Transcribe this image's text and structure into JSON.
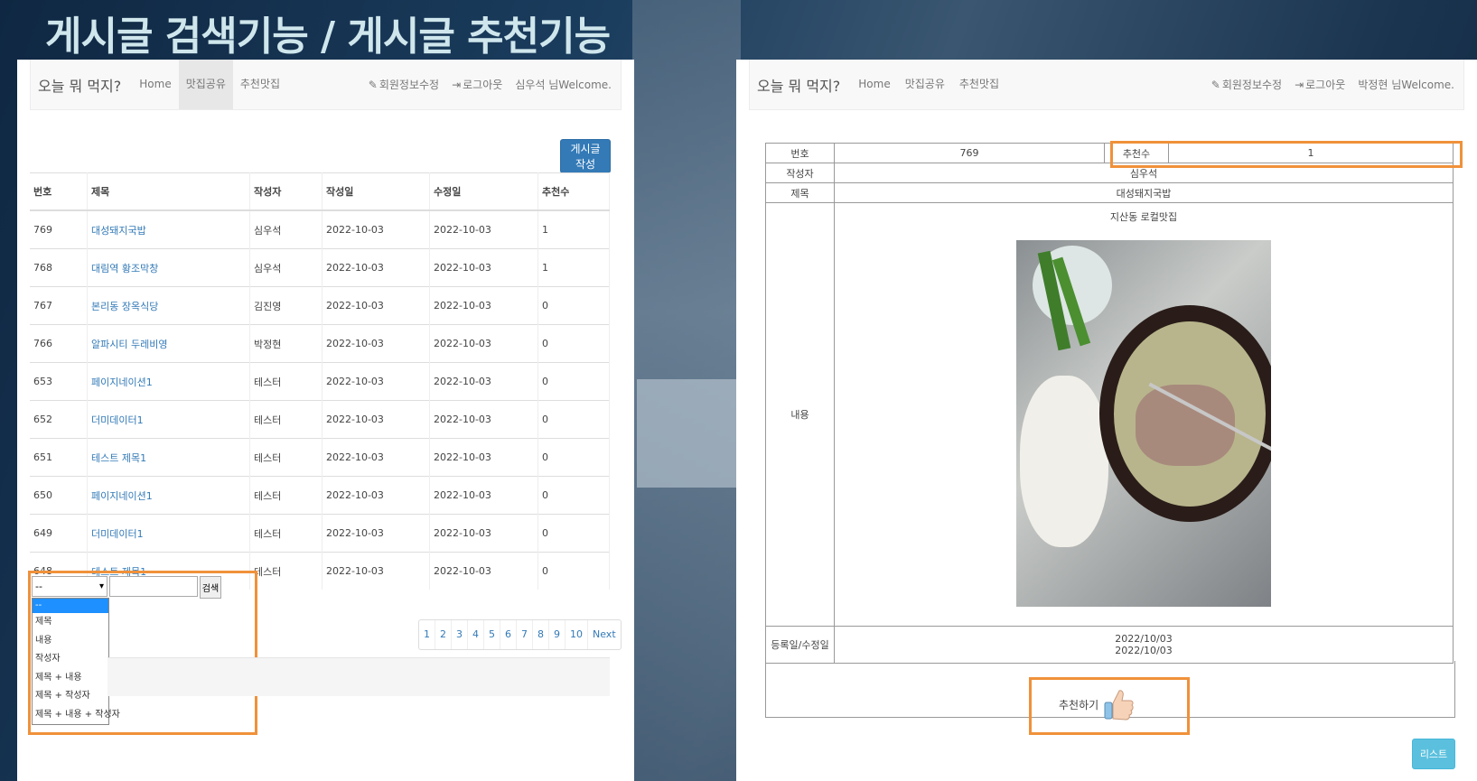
{
  "slide_title": "게시글 검색기능 / 게시글 추천기능",
  "left": {
    "nav": {
      "brand": "오늘 뭐 먹지?",
      "links": [
        "Home",
        "맛집공유",
        "추천맛집"
      ],
      "edit_profile": "회원정보수정",
      "logout": "로그아웃",
      "welcome": "심우석 님Welcome."
    },
    "write_button": "게시글 작성",
    "table": {
      "headers": [
        "번호",
        "제목",
        "작성자",
        "작성일",
        "수정일",
        "추천수"
      ],
      "rows": [
        [
          "769",
          "대성돼지국밥",
          "심우석",
          "2022-10-03",
          "2022-10-03",
          "1"
        ],
        [
          "768",
          "대림역 황조막창",
          "심우석",
          "2022-10-03",
          "2022-10-03",
          "1"
        ],
        [
          "767",
          "본리동 장옥식당",
          "김진영",
          "2022-10-03",
          "2022-10-03",
          "0"
        ],
        [
          "766",
          "알파시티 두레비영",
          "박정현",
          "2022-10-03",
          "2022-10-03",
          "0"
        ],
        [
          "653",
          "페이지네이션1",
          "테스터",
          "2022-10-03",
          "2022-10-03",
          "0"
        ],
        [
          "652",
          "더미데이터1",
          "테스터",
          "2022-10-03",
          "2022-10-03",
          "0"
        ],
        [
          "651",
          "테스트 제목1",
          "테스터",
          "2022-10-03",
          "2022-10-03",
          "0"
        ],
        [
          "650",
          "페이지네이션1",
          "테스터",
          "2022-10-03",
          "2022-10-03",
          "0"
        ],
        [
          "649",
          "더미데이터1",
          "테스터",
          "2022-10-03",
          "2022-10-03",
          "0"
        ],
        [
          "648",
          "테스트 제목1",
          "테스터",
          "2022-10-03",
          "2022-10-03",
          "0"
        ]
      ]
    },
    "search": {
      "selected": "--",
      "options": [
        "--",
        "제목",
        "내용",
        "작성자",
        "제목 + 내용",
        "제목 + 작성자",
        "제목 + 내용 + 작성자"
      ],
      "button": "검색"
    },
    "pagination": [
      "1",
      "2",
      "3",
      "4",
      "5",
      "6",
      "7",
      "8",
      "9",
      "10",
      "Next"
    ]
  },
  "right": {
    "nav": {
      "brand": "오늘 뭐 먹지?",
      "links": [
        "Home",
        "맛집공유",
        "추천맛집"
      ],
      "edit_profile": "회원정보수정",
      "logout": "로그아웃",
      "welcome": "박정현 님Welcome."
    },
    "detail": {
      "no_label": "번호",
      "no_value": "769",
      "rec_label": "추천수",
      "rec_value": "1",
      "author_label": "작성자",
      "author_value": "심우석",
      "title_label": "제목",
      "title_value": "대성돼지국밥",
      "content_label": "내용",
      "content_text": "지산동 로컬맛집",
      "date_label": "등록일/수정일",
      "created": "2022/10/03",
      "modified": "2022/10/03"
    },
    "recommend_label": "추천하기",
    "list_button": "리스트"
  }
}
